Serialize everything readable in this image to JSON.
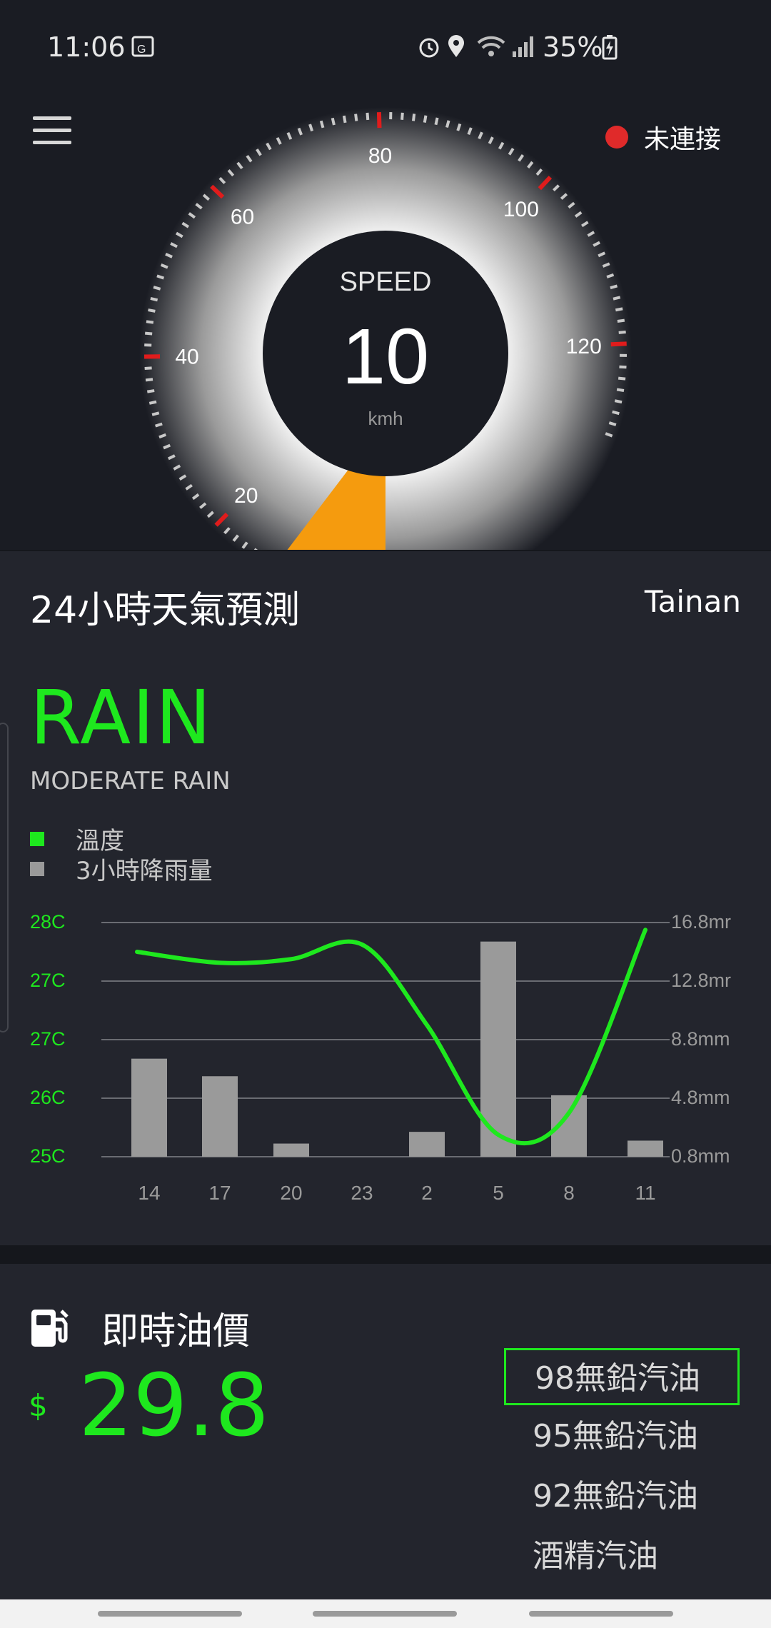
{
  "status": {
    "time": "11:06",
    "battery": "35%",
    "icons": [
      "gallery-icon",
      "alarm-icon",
      "location-icon",
      "wifi-icon",
      "signal-icon",
      "battery-charging-icon"
    ]
  },
  "header": {
    "connection_label": "未連接",
    "connection_color": "#e02a2a"
  },
  "gauge": {
    "label": "SPEED",
    "value": "10",
    "unit": "kmh",
    "speed": 10,
    "tick_labels": [
      "20",
      "40",
      "60",
      "80",
      "100",
      "120"
    ],
    "needle_color": "#f59b0e"
  },
  "weather": {
    "title": "24小時天氣預測",
    "city": "Tainan",
    "condition": "RAIN",
    "description": "MODERATE RAIN",
    "legend": [
      {
        "label": "溫度",
        "color": "#1ee81e"
      },
      {
        "label": "3小時降雨量",
        "color": "#9a9a9a"
      }
    ]
  },
  "chart_data": {
    "type": "bar",
    "categories": [
      "14",
      "17",
      "20",
      "23",
      "2",
      "5",
      "8",
      "11"
    ],
    "left_ticks": [
      "28C",
      "27C",
      "27C",
      "26C",
      "25C"
    ],
    "right_ticks": [
      "16.8mr",
      "12.8mr",
      "8.8mm",
      "4.8mm",
      "0.8mm"
    ],
    "series": [
      {
        "name": "3小時降雨量",
        "type": "bar",
        "values": [
          7.5,
          6.3,
          1.7,
          0.8,
          2.5,
          15.5,
          5.0,
          1.9
        ],
        "color": "#9a9a9a"
      },
      {
        "name": "溫度",
        "type": "line",
        "values": [
          27.8,
          27.65,
          27.7,
          27.9,
          26.8,
          25.3,
          25.6,
          28.1
        ],
        "color": "#1ee81e"
      }
    ],
    "rain_range": [
      0.8,
      16.8
    ],
    "temp_range": [
      25.0,
      28.2
    ]
  },
  "fuel": {
    "title": "即時油價",
    "currency": "$",
    "price": "29.8",
    "options": [
      "98無鉛汽油",
      "95無鉛汽油",
      "92無鉛汽油",
      "酒精汽油"
    ],
    "selected_index": 0
  }
}
